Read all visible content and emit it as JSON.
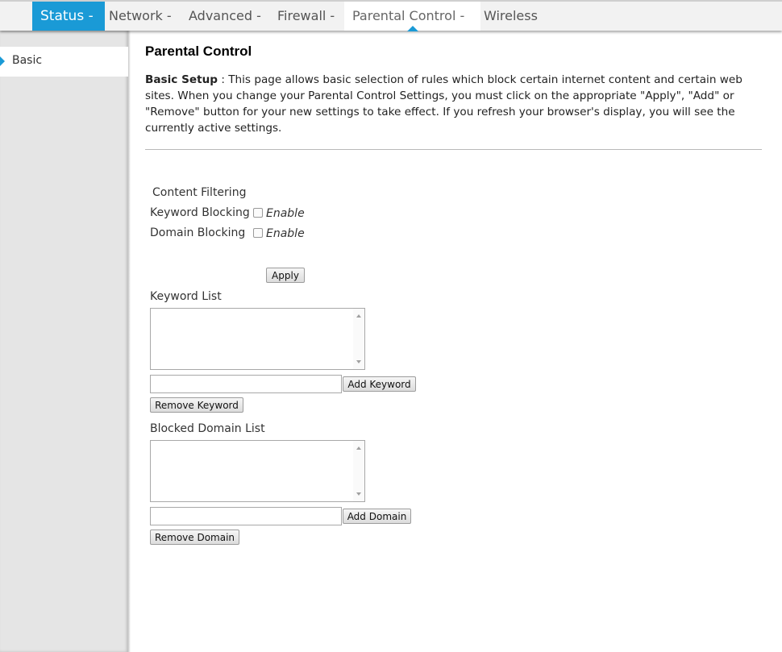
{
  "nav": {
    "items": [
      {
        "label": "Status -"
      },
      {
        "label": "Network -"
      },
      {
        "label": "Advanced -"
      },
      {
        "label": "Firewall -"
      },
      {
        "label": "Parental Control -"
      },
      {
        "label": "Wireless"
      }
    ],
    "active_index": 0,
    "selected_index": 4,
    "accent_color": "#1a9ad6"
  },
  "sidebar": {
    "items": [
      {
        "label": "Basic",
        "icon": "caret-right-icon"
      }
    ]
  },
  "main": {
    "title": "Parental Control",
    "description_lead": "Basic Setup",
    "description_sep": " : ",
    "description_text": "This page allows basic selection of rules which block certain internet content and certain web sites. When you change your Parental Control Settings, you must click on the appropriate \"Apply\", \"Add\" or \"Remove\" button for your new settings to take effect. If you refresh your browser's display, you will see the currently active settings.",
    "content_filtering": {
      "heading": "Content Filtering",
      "keyword_blocking_label": "Keyword Blocking",
      "keyword_enable_label": "Enable",
      "keyword_enabled": false,
      "domain_blocking_label": "Domain Blocking",
      "domain_enable_label": "Enable",
      "domain_enabled": false,
      "apply_label": "Apply"
    },
    "keyword": {
      "list_label": "Keyword List",
      "input_value": "",
      "add_label": "Add Keyword",
      "remove_label": "Remove Keyword"
    },
    "domain": {
      "list_label": "Blocked Domain List",
      "input_value": "",
      "add_label": "Add Domain",
      "remove_label": "Remove Domain"
    }
  }
}
